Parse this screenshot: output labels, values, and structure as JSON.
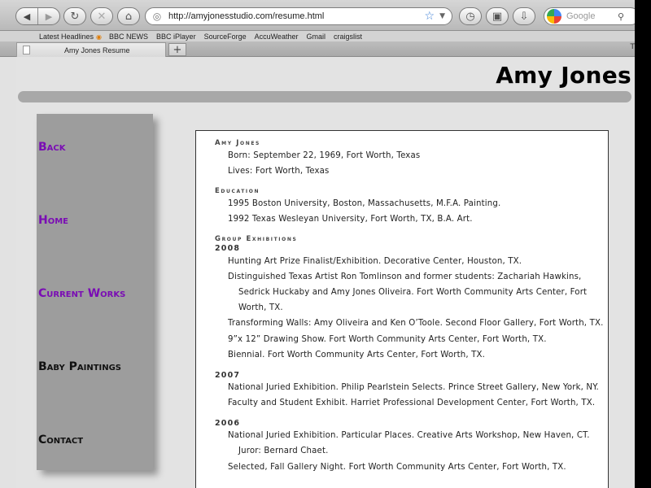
{
  "browser": {
    "url": "http://amyjonesstudio.com/resume.html",
    "search_placeholder": "Google",
    "tab_title": "Amy Jones Resume",
    "new_tab_label": "+",
    "tab_overflow": "T",
    "bookmarks": [
      "Latest Headlines",
      "BBC NEWS",
      "BBC iPlayer",
      "SourceForge",
      "AccuWeather",
      "Gmail",
      "craigslist"
    ]
  },
  "site": {
    "title": "Amy Jones",
    "nav": [
      {
        "label": "Back",
        "color": "#7a0db4"
      },
      {
        "label": "Home",
        "color": "#7a0db4"
      },
      {
        "label": "Current Works",
        "color": "#7a0db4"
      },
      {
        "label": "Baby Paintings",
        "color": "#111111"
      },
      {
        "label": "Contact",
        "color": "#111111"
      }
    ]
  },
  "resume": {
    "name_heading": "Amy Jones",
    "born": "Born: September 22, 1969, Fort Worth, Texas",
    "lives": "Lives: Fort Worth, Texas",
    "education_heading": "Education",
    "education": [
      "1995 Boston University, Boston, Massachusetts, M.F.A. Painting.",
      "1992 Texas Wesleyan University, Fort Worth, TX, B.A. Art."
    ],
    "group_heading": "Group Exhibitions",
    "year_2008": "2008",
    "y2008": [
      "Hunting Art Prize Finalist/Exhibition. Decorative Center, Houston, TX.",
      "Distinguished Texas Artist Ron Tomlinson and former students: Zachariah Hawkins,",
      "Sedrick Huckaby and Amy Jones Oliveira. Fort Worth Community Arts Center, Fort",
      "Worth, TX.",
      "Transforming Walls: Amy Oliveira and Ken O’Toole. Second Floor Gallery, Fort Worth, TX.",
      "9”x 12” Drawing Show. Fort Worth Community Arts Center, Fort Worth, TX.",
      "Biennial. Fort Worth Community Arts Center, Fort Worth, TX."
    ],
    "year_2007": "2007",
    "y2007": [
      "National Juried Exhibition. Philip Pearlstein Selects. Prince Street Gallery, New York, NY.",
      "Faculty and Student Exhibit. Harriet Professional Development Center, Fort Worth, TX."
    ],
    "year_2006": "2006",
    "y2006": [
      "National Juried Exhibition. Particular Places. Creative Arts Workshop, New Haven, CT.",
      "Juror: Bernard Chaet.",
      "Selected, Fall Gallery Night. Fort Worth Community Arts Center, Fort Worth, TX."
    ]
  }
}
